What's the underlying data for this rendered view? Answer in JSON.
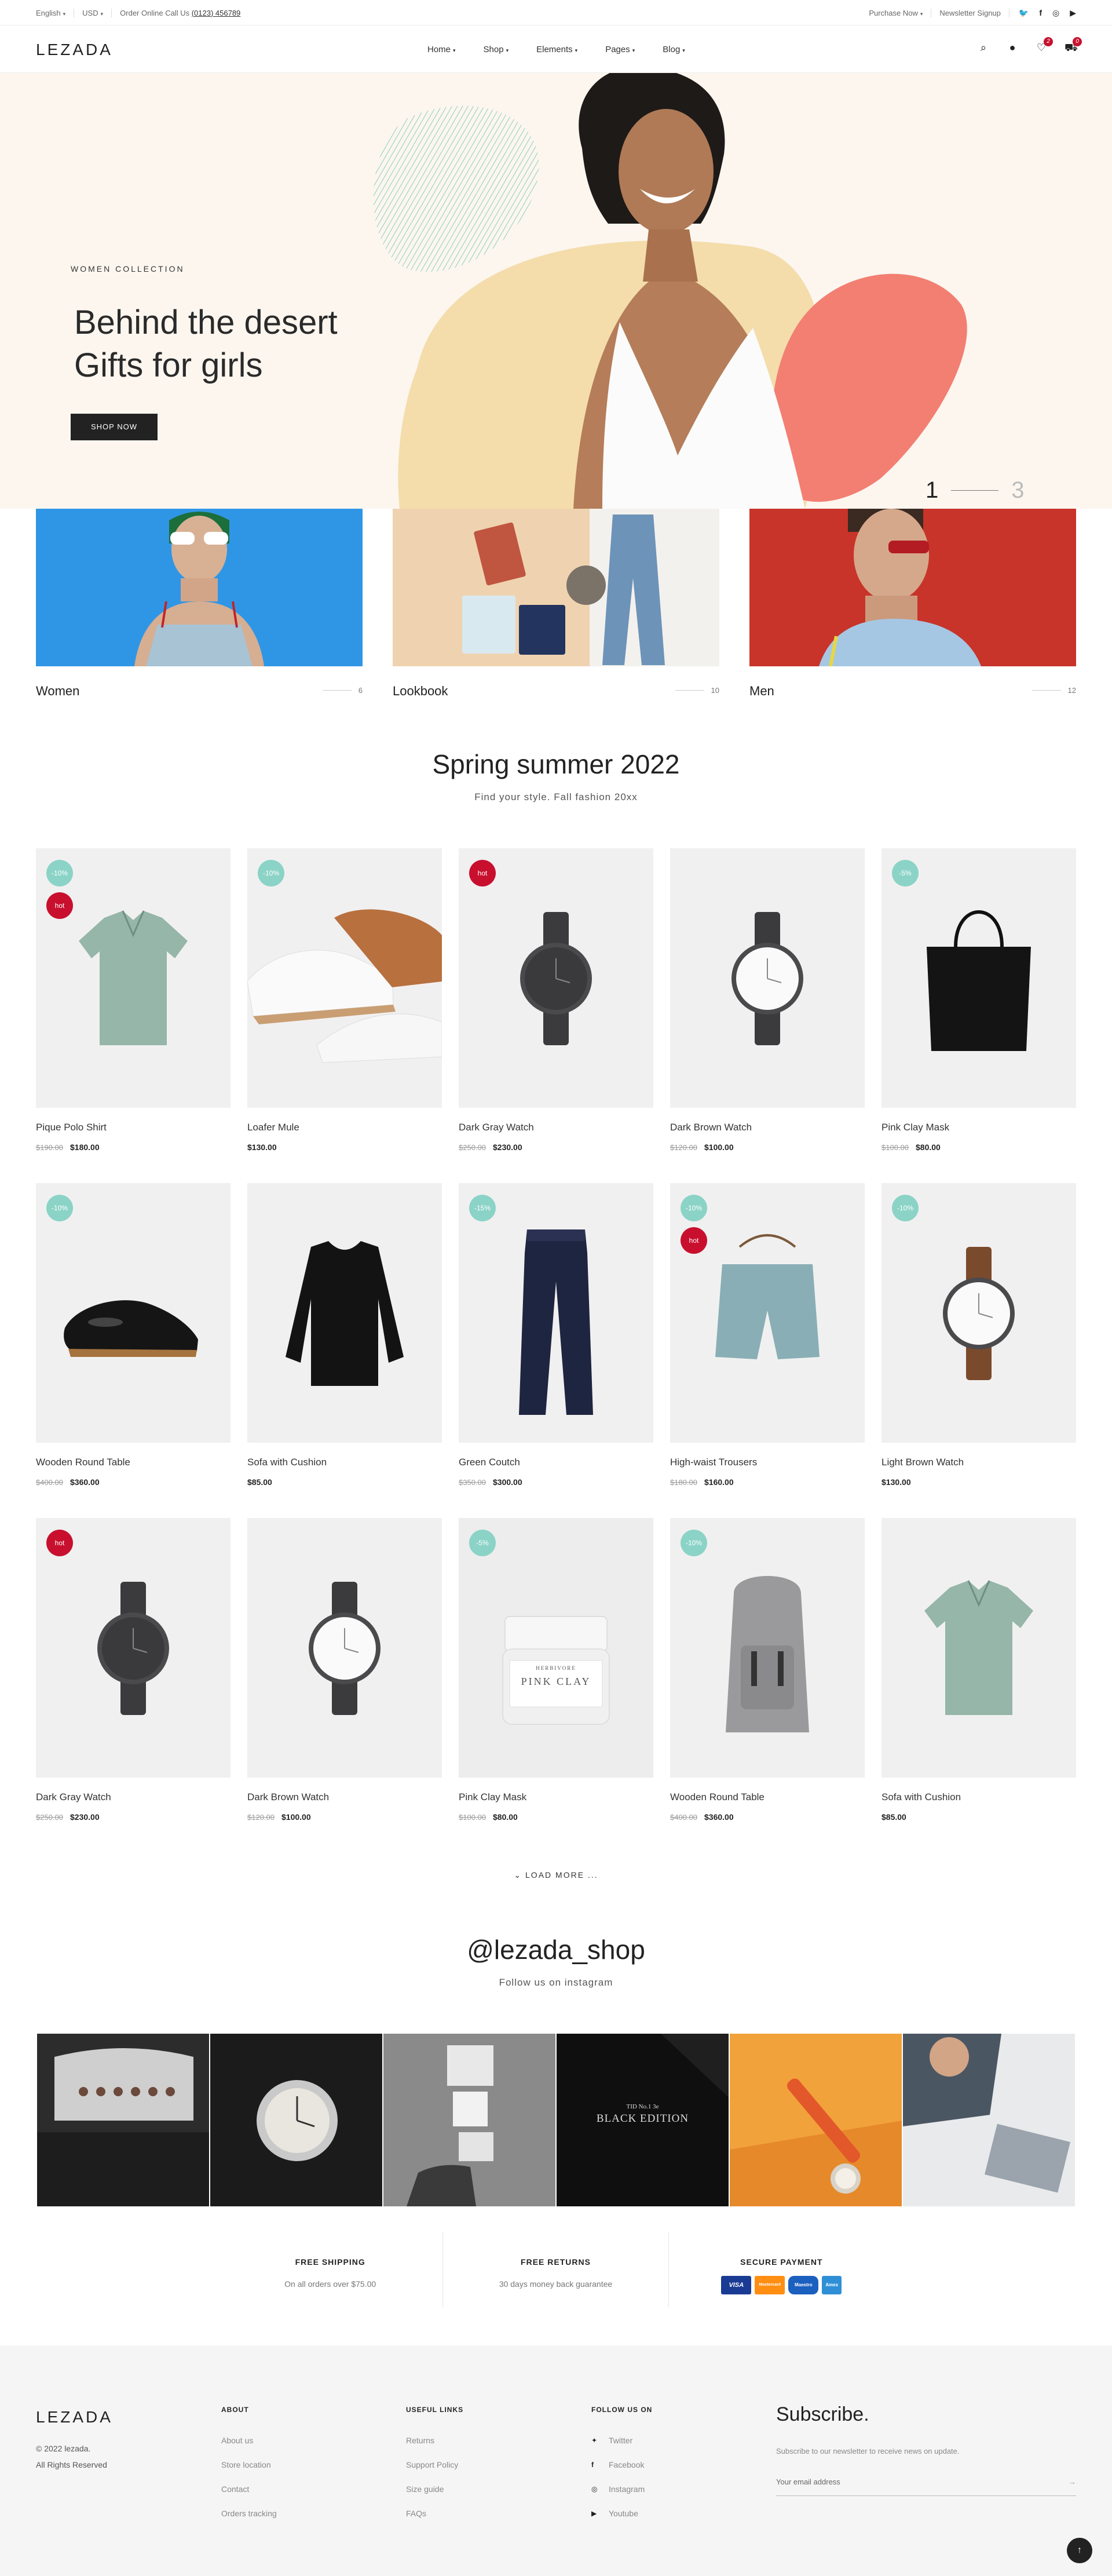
{
  "topbar": {
    "language": "English",
    "currency": "USD",
    "call_prefix": "Order Online Call Us",
    "phone": "(0123) 456789",
    "purchase": "Purchase Now",
    "newsletter": "Newsletter Signup",
    "social_icons": [
      "twitter-icon",
      "facebook-icon",
      "instagram-icon",
      "youtube-icon"
    ]
  },
  "header": {
    "logo": "LEZADA",
    "nav": [
      "Home",
      "Shop",
      "Elements",
      "Pages",
      "Blog"
    ],
    "wishlist_count": "2",
    "cart_count": "0"
  },
  "hero": {
    "kicker": "WOMEN COLLECTION",
    "title_line1": "Behind the desert",
    "title_line2": "Gifts for girls",
    "button": "SHOP NOW",
    "slide_current": "1",
    "slide_total": "3"
  },
  "categories": [
    {
      "label": "Women",
      "count": "6"
    },
    {
      "label": "Lookbook",
      "count": "10"
    },
    {
      "label": "Men",
      "count": "12"
    }
  ],
  "products_section": {
    "title": "Spring summer 2022",
    "subtitle": "Find your style. Fall fashion 20xx"
  },
  "products": [
    {
      "name": "Pique Polo Shirt",
      "old": "$190.00",
      "price": "$180.00",
      "discount": "-10%",
      "hot": "hot",
      "kind": "polo"
    },
    {
      "name": "Loafer Mule",
      "old": "",
      "price": "$130.00",
      "discount": "-10%",
      "hot": "",
      "kind": "mule"
    },
    {
      "name": "Dark Gray Watch",
      "old": "$250.00",
      "price": "$230.00",
      "discount": "",
      "hot": "hot",
      "kind": "watch-dark"
    },
    {
      "name": "Dark Brown Watch",
      "old": "$120.00",
      "price": "$100.00",
      "discount": "",
      "hot": "",
      "kind": "watch-white"
    },
    {
      "name": "Pink Clay Mask",
      "old": "$100.00",
      "price": "$80.00",
      "discount": "-5%",
      "hot": "",
      "kind": "bag"
    },
    {
      "name": "Wooden Round Table",
      "old": "$400.00",
      "price": "$360.00",
      "discount": "-10%",
      "hot": "",
      "kind": "loafer"
    },
    {
      "name": "Sofa with Cushion",
      "old": "",
      "price": "$85.00",
      "discount": "",
      "hot": "",
      "kind": "sweater"
    },
    {
      "name": "Green Coutch",
      "old": "$350.00",
      "price": "$300.00",
      "discount": "-15%",
      "hot": "",
      "kind": "pants"
    },
    {
      "name": "High-waist Trousers",
      "old": "$180.00",
      "price": "$160.00",
      "discount": "-10%",
      "hot": "hot",
      "kind": "shorts"
    },
    {
      "name": "Light Brown Watch",
      "old": "",
      "price": "$130.00",
      "discount": "-10%",
      "hot": "",
      "kind": "watch-brown"
    },
    {
      "name": "Dark Gray Watch",
      "old": "$250.00",
      "price": "$230.00",
      "discount": "",
      "hot": "hot",
      "kind": "watch-dark"
    },
    {
      "name": "Dark Brown Watch",
      "old": "$120.00",
      "price": "$100.00",
      "discount": "",
      "hot": "",
      "kind": "watch-white"
    },
    {
      "name": "Pink Clay Mask",
      "old": "$100.00",
      "price": "$80.00",
      "discount": "-5%",
      "hot": "",
      "kind": "jar"
    },
    {
      "name": "Wooden Round Table",
      "old": "$400.00",
      "price": "$360.00",
      "discount": "-10%",
      "hot": "",
      "kind": "backpack"
    },
    {
      "name": "Sofa with Cushion",
      "old": "",
      "price": "$85.00",
      "discount": "",
      "hot": "",
      "kind": "polo"
    }
  ],
  "load_more": "LOAD MORE ...",
  "instagram": {
    "handle": "@lezada_shop",
    "subtitle": "Follow us on instagram",
    "tile_text_small": "TID No.1 3e",
    "tile_text_big": "BLACK EDITION"
  },
  "features": [
    {
      "title": "FREE SHIPPING",
      "text": "On all orders over $75.00"
    },
    {
      "title": "FREE RETURNS",
      "text": "30 days money back guarantee"
    },
    {
      "title": "SECURE PAYMENT",
      "text": ""
    }
  ],
  "payment_cards": [
    "VISA",
    "Mastercard",
    "Maestro",
    "Amex"
  ],
  "jar_label": "PINK CLAY",
  "jar_brand": "HERBIVORE",
  "footer": {
    "logo": "LEZADA",
    "copyright": "© 2022 lezada.",
    "rights": "All Rights Reserved",
    "about_title": "ABOUT",
    "about": [
      "About us",
      "Store location",
      "Contact",
      "Orders tracking"
    ],
    "links_title": "USEFUL LINKS",
    "links": [
      "Returns",
      "Support Policy",
      "Size guide",
      "FAQs"
    ],
    "follow_title": "FOLLOW US ON",
    "follow": [
      "Twitter",
      "Facebook",
      "Instagram",
      "Youtube"
    ],
    "subscribe_title": "Subscribe.",
    "subscribe_text": "Subscribe to our newsletter to receive news on update.",
    "email_placeholder": "Your email address"
  },
  "colors": {
    "accent": "#c8102e",
    "discount": "#8bd3c7",
    "hero_bg": "#fcf6ef",
    "dark": "#222222"
  }
}
